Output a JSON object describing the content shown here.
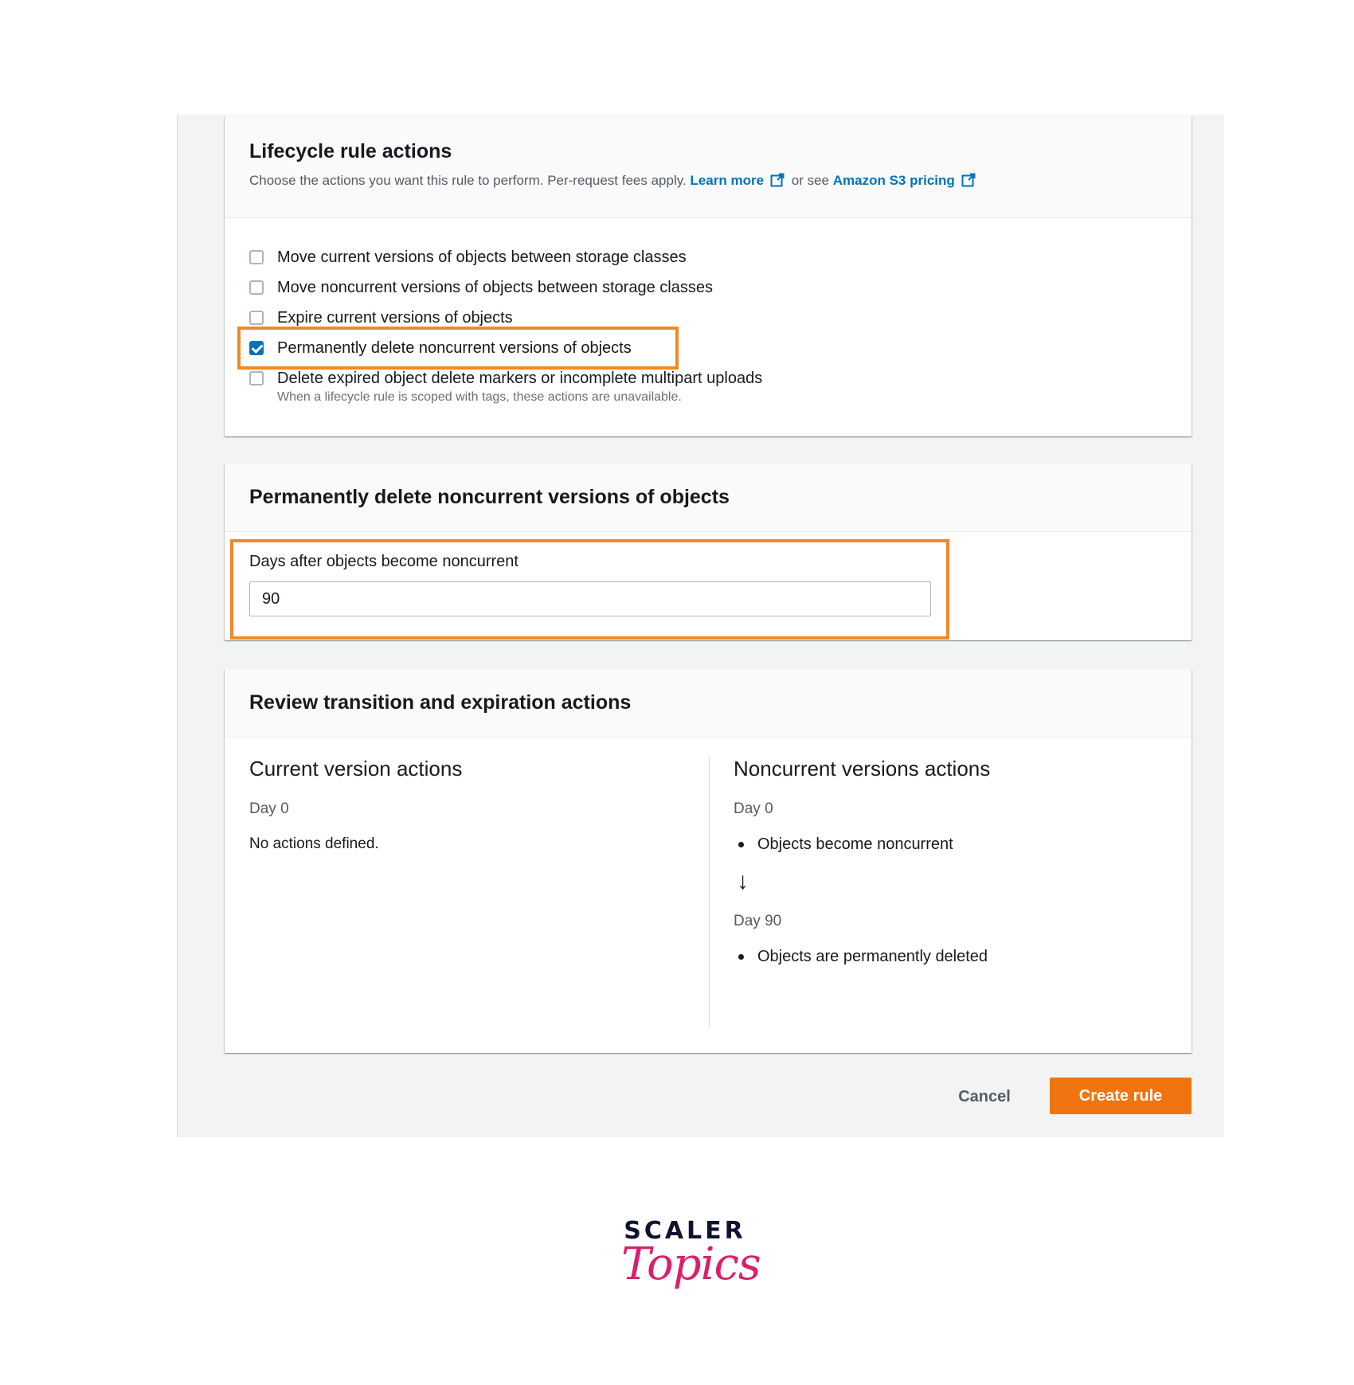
{
  "lifecycle_actions": {
    "title": "Lifecycle rule actions",
    "description": "Choose the actions you want this rule to perform. Per-request fees apply.",
    "learn_more": "Learn more",
    "or_see": "or see",
    "pricing_link": "Amazon S3 pricing",
    "options": [
      {
        "label": "Move current versions of objects between storage classes",
        "checked": false
      },
      {
        "label": "Move noncurrent versions of objects between storage classes",
        "checked": false
      },
      {
        "label": "Expire current versions of objects",
        "checked": false
      },
      {
        "label": "Permanently delete noncurrent versions of objects",
        "checked": true
      },
      {
        "label": "Delete expired object delete markers or incomplete multipart uploads",
        "checked": false
      }
    ],
    "option_hint": "When a lifecycle rule is scoped with tags, these actions are unavailable."
  },
  "permanent_delete": {
    "title": "Permanently delete noncurrent versions of objects",
    "field_label": "Days after objects become noncurrent",
    "field_value": "90"
  },
  "review": {
    "title": "Review transition and expiration actions",
    "current": {
      "title": "Current version actions",
      "day": "Day 0",
      "text": "No actions defined."
    },
    "noncurrent": {
      "title": "Noncurrent versions actions",
      "day_start": "Day 0",
      "event_start": "Objects become noncurrent",
      "arrow": "↓",
      "day_end": "Day 90",
      "event_end": "Objects are permanently deleted"
    }
  },
  "buttons": {
    "cancel": "Cancel",
    "create": "Create rule"
  },
  "logo": {
    "line1": "SCALER",
    "line2": "Topics"
  },
  "colors": {
    "accent_orange": "#f0740f",
    "highlight_orange": "#f08a24",
    "link_blue": "#0073bb"
  }
}
